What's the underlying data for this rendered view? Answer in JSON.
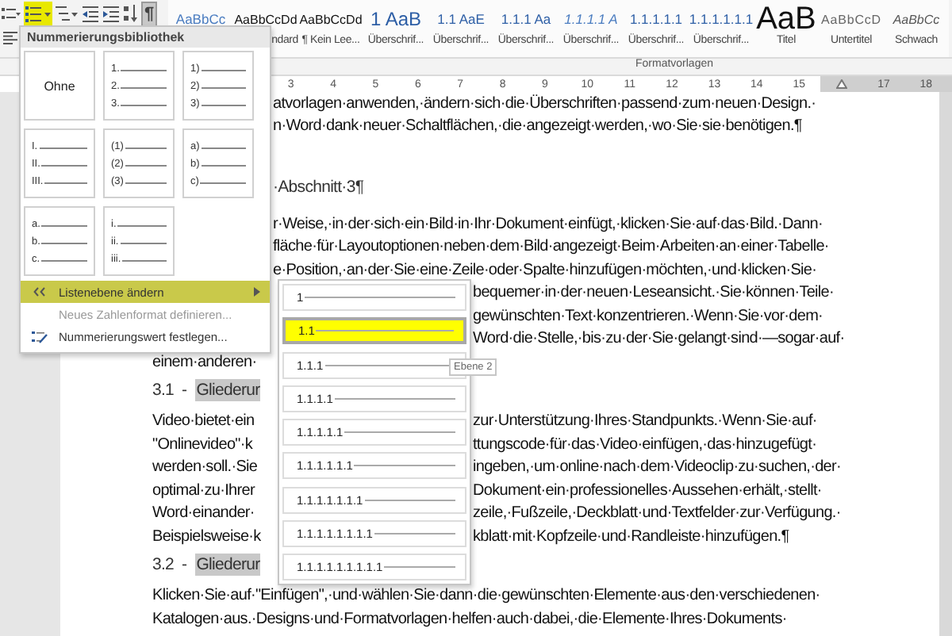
{
  "toolbar": {
    "buttons": [
      {
        "kind": "bullets",
        "selected": false,
        "pressed": false
      },
      {
        "kind": "numbering",
        "selected": true,
        "pressed": false
      },
      {
        "kind": "multilevel",
        "selected": false,
        "pressed": false
      },
      {
        "kind": "outdent",
        "selected": false,
        "pressed": false
      },
      {
        "kind": "indent",
        "selected": false,
        "pressed": false
      },
      {
        "kind": "sort",
        "selected": false,
        "pressed": false
      },
      {
        "kind": "pilcrow",
        "label": "¶",
        "selected": false,
        "pressed": true
      }
    ],
    "row2": [
      {
        "kind": "align_left"
      }
    ]
  },
  "styles_gallery": {
    "items": [
      {
        "kind": "accent",
        "preview": "AaBbCc"
      },
      {
        "kind": "normal",
        "preview": "AaBbCcDd",
        "label_tail": "ndard"
      },
      {
        "kind": "normal",
        "preview": "AaBbCcDd",
        "label": "¶ Kein Lee..."
      },
      {
        "kind": "heading1",
        "preview": "1 AaB",
        "label": "Überschrif..."
      },
      {
        "kind": "heading",
        "preview": "1.1 AaE",
        "label": "Überschrif..."
      },
      {
        "kind": "heading",
        "preview": "1.1.1 Aa",
        "label": "Überschrif..."
      },
      {
        "kind": "heading_italic",
        "preview": "1.1.1.1 A",
        "label": "Überschrif..."
      },
      {
        "kind": "heading",
        "preview": "1.1.1.1.1",
        "label": "Überschrif..."
      },
      {
        "kind": "heading",
        "preview": "1.1.1.1.1.1",
        "label": "Überschrif..."
      },
      {
        "kind": "title",
        "preview": "AaB",
        "label": "Titel"
      },
      {
        "kind": "subtitle",
        "preview": "AaBbCcD",
        "label": "Untertitel"
      },
      {
        "kind": "emphasis",
        "preview": "AaBbCc",
        "label": "Schwach"
      }
    ],
    "group_label": "Formatvorlagen"
  },
  "ruler": [
    {
      "kind": "number",
      "label": "3",
      "margin": false
    },
    {
      "kind": "number",
      "label": "4",
      "margin": false
    },
    {
      "kind": "number",
      "label": "5",
      "margin": false
    },
    {
      "kind": "number",
      "label": "6",
      "margin": false
    },
    {
      "kind": "number",
      "label": "7",
      "margin": false
    },
    {
      "kind": "number",
      "label": "8",
      "margin": false
    },
    {
      "kind": "number",
      "label": "9",
      "margin": false
    },
    {
      "kind": "number",
      "label": "10",
      "margin": false
    },
    {
      "kind": "number",
      "label": "11",
      "margin": false
    },
    {
      "kind": "number",
      "label": "12",
      "margin": false
    },
    {
      "kind": "number",
      "label": "13",
      "margin": false
    },
    {
      "kind": "number",
      "label": "14",
      "margin": false
    },
    {
      "kind": "number",
      "label": "15",
      "margin": false
    },
    {
      "kind": "marker",
      "margin": true
    },
    {
      "kind": "number",
      "label": "17",
      "margin": true
    },
    {
      "kind": "number",
      "label": "18",
      "margin": true
    }
  ],
  "document": {
    "beside_menu": [
      {
        "kind": "para",
        "right": "atvorlagen·anwenden,·ändern·sich·die·Überschriften·passend·zum·neuen·Design.·"
      },
      {
        "kind": "para",
        "right": "n·Word·dank·neuer·Schaltflächen,·die·angezeigt·werden,·wo·Sie·sie·benötigen.¶"
      },
      {
        "kind": "heading1",
        "right": "·Abschnitt·3¶"
      },
      {
        "kind": "para",
        "right": "r·Weise,·in·der·sich·ein·Bild·in·Ihr·Dokument·einfügt,·klicken·Sie·auf·das·Bild.·Dann·"
      },
      {
        "kind": "para",
        "right": "fläche·für·Layoutoptionen·neben·dem·Bild·angezeigt·Beim·Arbeiten·an·einer·Tabelle·"
      },
      {
        "kind": "para",
        "right": "e·Position,·an·der·Sie·eine·Zeile·oder·Spalte·hinzufügen·möchten,·und·klicken·Sie·"
      }
    ],
    "beside_submenu": [
      {
        "kind": "para",
        "right": "bequemer·in·der·neuen·Leseansicht.·Sie·können·Teile·"
      },
      {
        "kind": "para",
        "right": "gewünschten·Text·konzentrieren.·Wenn·Sie·vor·dem·"
      },
      {
        "kind": "para",
        "right": "Word·die·Stelle,·bis·zu·der·Sie·gelangt·sind·—sogar·auf·"
      },
      {
        "kind": "para",
        "left": "einem·anderen·"
      },
      {
        "kind": "heading2",
        "number": "3.1",
        "separator": "-",
        "title": "Gliederur"
      },
      {
        "kind": "para",
        "left": "Video·bietet·ein",
        "right": "zur·Unterstützung·Ihres·Standpunkts.·Wenn·Sie·auf·"
      },
      {
        "kind": "para",
        "left": "\"Onlinevideo\"·k",
        "right": "ttungscode·für·das·Video·einfügen,·das·hinzugefügt·"
      },
      {
        "kind": "para",
        "left": "werden·soll.·Sie",
        "right": "ingeben,·um·online·nach·dem·Videoclip·zu·suchen,·der·"
      },
      {
        "kind": "para",
        "left": "optimal·zu·Ihrer",
        "right": "Dokument·ein·professionelles·Aussehen·erhält,·stellt·"
      },
      {
        "kind": "para",
        "left": "Word·einander·",
        "right": "zeile,·Fußzeile,·Deckblatt·und·Textfelder·zur·Verfügung.·"
      },
      {
        "kind": "para",
        "left": "Beispielsweise·k",
        "right": "kblatt·mit·Kopfzeile·und·Randleiste·hinzufügen.¶"
      },
      {
        "kind": "heading2",
        "number": "3.2",
        "separator": "-",
        "title": "Gliederur"
      }
    ],
    "below_menus": [
      {
        "kind": "para",
        "text": "Klicken·Sie·auf·\"Einfügen\",·und·wählen·Sie·dann·die·gewünschten·Elemente·aus·den·verschiedenen·"
      },
      {
        "kind": "para",
        "text": "Katalogen·aus.·Designs·und·Formatvorlagen·helfen·auch·dabei,·die·Elemente·Ihres·Dokuments·"
      }
    ]
  },
  "numbering_menu": {
    "title": "Nummerierungsbibliothek",
    "cells": [
      {
        "kind": "none",
        "label": "Ohne"
      },
      {
        "kind": "list",
        "markers": [
          "1.",
          "2.",
          "3."
        ]
      },
      {
        "kind": "list",
        "markers": [
          "1)",
          "2)",
          "3)"
        ]
      },
      {
        "kind": "list",
        "markers": [
          "I.",
          "II.",
          "III."
        ]
      },
      {
        "kind": "list",
        "markers": [
          "(1)",
          "(2)",
          "(3)"
        ]
      },
      {
        "kind": "list",
        "markers": [
          "a)",
          "b)",
          "c)"
        ]
      },
      {
        "kind": "list",
        "markers": [
          "a.",
          "b.",
          "c."
        ]
      },
      {
        "kind": "list",
        "markers": [
          "i.",
          "ii.",
          "iii."
        ]
      }
    ],
    "items": [
      {
        "kind": "submenu",
        "label": "Listenebene ändern",
        "selected": true,
        "disabled": false
      },
      {
        "kind": "command",
        "label": "Neues Zahlenformat definieren...",
        "selected": false,
        "disabled": true
      },
      {
        "kind": "command_icon",
        "label": "Nummerierungswert festlegen...",
        "selected": false,
        "disabled": false
      }
    ]
  },
  "level_submenu": {
    "items": [
      {
        "label": "1",
        "selected": false
      },
      {
        "label": "1.1",
        "selected": true
      },
      {
        "label": "1.1.1",
        "selected": false
      },
      {
        "label": "1.1.1.1",
        "selected": false
      },
      {
        "label": "1.1.1.1.1",
        "selected": false
      },
      {
        "label": "1.1.1.1.1.1",
        "selected": false
      },
      {
        "label": "1.1.1.1.1.1.1",
        "selected": false
      },
      {
        "label": "1.1.1.1.1.1.1.1",
        "selected": false
      },
      {
        "label": "1.1.1.1.1.1.1.1.1",
        "selected": false
      }
    ],
    "tooltip": "Ebene 2"
  }
}
